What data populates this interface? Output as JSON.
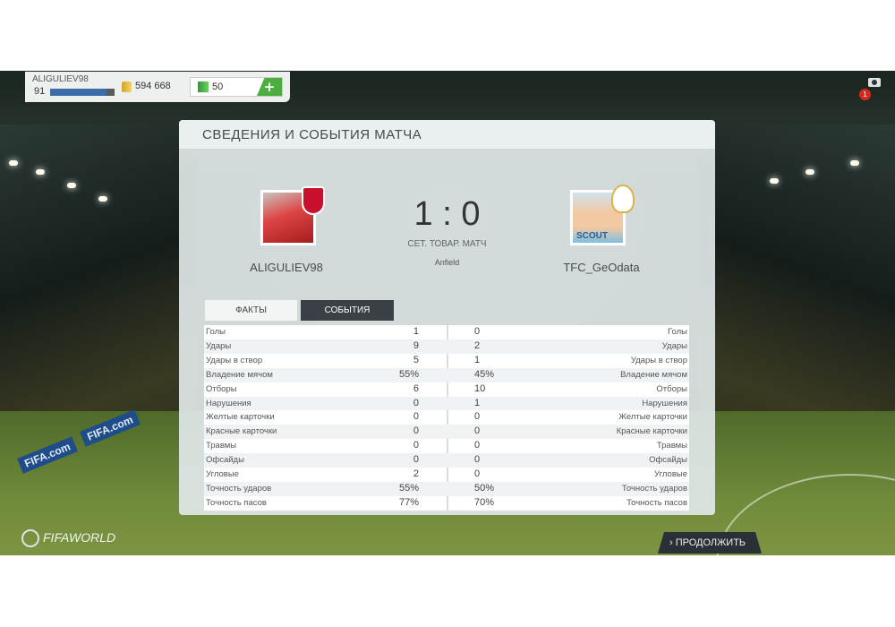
{
  "user": {
    "name": "ALIGULIEV98",
    "level": "91",
    "xp_fraction": 0.88,
    "coins": "594 668",
    "points": "50",
    "add_label": "+",
    "notifications": "1"
  },
  "panel": {
    "title": "СВЕДЕНИЯ И СОБЫТИЯ МАТЧА",
    "score": "1 : 0",
    "match_type": "СЕТ. ТОВАР. МАТЧ",
    "stadium": "Anfield",
    "home_team": "ALIGULIEV98",
    "away_team": "TFC_GeOdata",
    "scout_label": "SCOUT",
    "tabs": [
      "ФАКТЫ",
      "СОБЫТИЯ"
    ]
  },
  "stats": [
    {
      "label": "Голы",
      "home": "1",
      "away": "0"
    },
    {
      "label": "Удары",
      "home": "9",
      "away": "2"
    },
    {
      "label": "Удары в створ",
      "home": "5",
      "away": "1"
    },
    {
      "label": "Владение мячом",
      "home": "55%",
      "away": "45%"
    },
    {
      "label": "Отборы",
      "home": "6",
      "away": "10"
    },
    {
      "label": "Нарушения",
      "home": "0",
      "away": "1"
    },
    {
      "label": "Желтые карточки",
      "home": "0",
      "away": "0"
    },
    {
      "label": "Красные карточки",
      "home": "0",
      "away": "0"
    },
    {
      "label": "Травмы",
      "home": "0",
      "away": "0"
    },
    {
      "label": "Офсайды",
      "home": "0",
      "away": "0"
    },
    {
      "label": "Угловые",
      "home": "2",
      "away": "0"
    },
    {
      "label": "Точность ударов",
      "home": "55%",
      "away": "50%"
    },
    {
      "label": "Точность пасов",
      "home": "77%",
      "away": "70%"
    }
  ],
  "footer": {
    "logo_text": "FIFAWORLD",
    "continue_label": "ПРОДОЛЖИТЬ"
  },
  "icons": {
    "camera": "camera-icon",
    "coins": "coins-icon",
    "points": "points-icon",
    "arrow": "chevron-right-icon"
  }
}
